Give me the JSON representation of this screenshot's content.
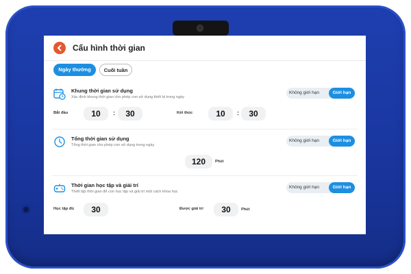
{
  "header": {
    "title": "Cấu hình thời gian"
  },
  "tabs": {
    "weekday": "Ngày thường",
    "weekend": "Cuối tuần"
  },
  "segment": {
    "no_limit": "Không giới hạn",
    "limit": "Giới hạn"
  },
  "time_window": {
    "title": "Khung thời gian sử dụng",
    "desc": "Xác định khung thời gian cho phép con sử dụng thiết bị trong ngày",
    "start_label": "Bắt đầu",
    "start_hour": "10",
    "start_minute": "30",
    "end_label": "Kết thúc",
    "end_hour": "10",
    "end_minute": "30",
    "separator": ":"
  },
  "total_time": {
    "title": "Tổng thời gian sử dụng",
    "desc": "Tổng thời gian cho phép con sử dụng trong ngày",
    "value": "120",
    "unit": "Phút"
  },
  "study_play": {
    "title": "Thời gian học tập và giải trí",
    "desc": "Thiết lập thời gian để con học tập và giải trí một cách khoa học",
    "study_label": "Học tập đủ",
    "study_value": "30",
    "play_label": "Được giải trí",
    "play_value": "30",
    "unit": "Phút"
  },
  "colors": {
    "case": "#1a37a0",
    "accent": "#1d8fe1",
    "back_button": "#e5572f"
  },
  "icons": [
    "back-arrow-icon",
    "calendar-clock-icon",
    "clock-icon",
    "gamepad-icon",
    "camera-icon",
    "speaker-icon"
  ]
}
